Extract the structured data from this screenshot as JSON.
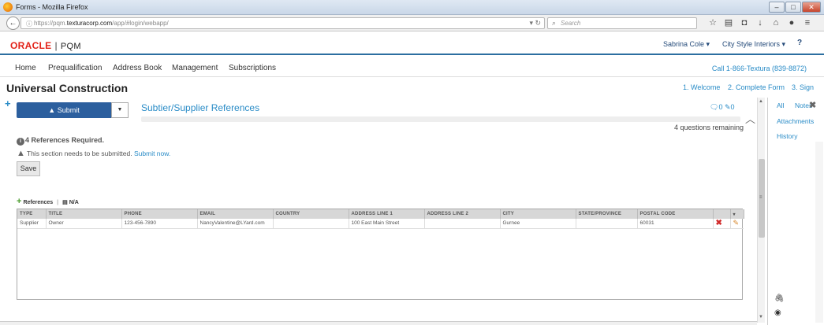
{
  "window": {
    "title": "Forms - Mozilla Firefox"
  },
  "browser": {
    "url_prefix": "https://pqm.",
    "url_domain": "texturacorp.com",
    "url_path": "/app/#login/webapp/",
    "search_placeholder": "Search"
  },
  "app": {
    "brand": "ORACLE",
    "product": "PQM",
    "user": "Sabrina Cole ▾",
    "company": "City Style Interiors ▾",
    "help": "?"
  },
  "menu": {
    "items": [
      "Home",
      "Prequalification",
      "Address Book",
      "Management",
      "Subscriptions"
    ],
    "call": "Call 1-866-Textura (839-8872)"
  },
  "page": {
    "title": "Universal Construction",
    "steps": [
      "1. Welcome",
      "2. Complete Form",
      "3. Sign"
    ]
  },
  "form": {
    "submit_label": "Submit",
    "section_title": "Subtier/Supplier References",
    "comment_count": "0",
    "attachment_count": "0",
    "remaining": "4 questions remaining",
    "required": "4 References Required.",
    "notice": "This section needs to be submitted.",
    "notice_link": "Submit now.",
    "save_label": "Save",
    "references_label": "References",
    "na_label": "N/A"
  },
  "grid": {
    "columns": [
      "TYPE",
      "TITLE",
      "PHONE",
      "EMAIL",
      "COUNTRY",
      "ADDRESS LINE 1",
      "ADDRESS LINE 2",
      "CITY",
      "STATE/PROVINCE",
      "POSTAL CODE"
    ],
    "rows": [
      [
        "Supplier",
        "Owner",
        "123-456-7890",
        "NancyValentine@LYard.com",
        "",
        "100 East Main Street",
        "",
        "Gurnee",
        "",
        "60031"
      ]
    ]
  },
  "side_panel": {
    "tabs": [
      "All",
      "Notes",
      "Attachments",
      "History"
    ]
  }
}
